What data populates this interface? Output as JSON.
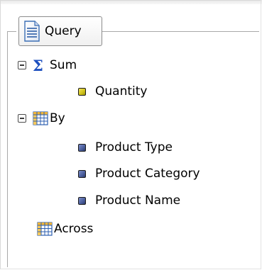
{
  "panel": {
    "legend": {
      "label": "Query",
      "icon": "document-icon"
    }
  },
  "tree": {
    "sum": {
      "label": "Sum",
      "icon": "sigma-icon",
      "expanded": true,
      "fields": [
        {
          "label": "Quantity",
          "icon": "measure-field-icon"
        }
      ]
    },
    "by": {
      "label": "By",
      "icon": "grid-icon",
      "expanded": true,
      "fields": [
        {
          "label": "Product Type",
          "icon": "dimension-field-icon"
        },
        {
          "label": "Product Category",
          "icon": "dimension-field-icon"
        },
        {
          "label": "Product Name",
          "icon": "dimension-field-icon"
        }
      ]
    },
    "across": {
      "label": "Across",
      "icon": "grid-icon"
    }
  },
  "colors": {
    "sigma": "#1d4fbf",
    "measure": "#cfc21a",
    "dimension": "#4a5d9c",
    "border": "#a9a9a9"
  }
}
